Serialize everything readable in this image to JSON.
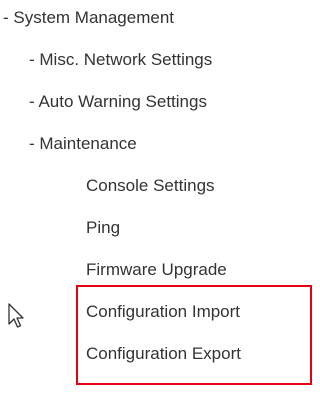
{
  "menu": {
    "system_management": "- System Management",
    "misc_network_settings": "- Misc. Network Settings",
    "auto_warning_settings": "- Auto Warning Settings",
    "maintenance": "- Maintenance",
    "console_settings": "Console Settings",
    "ping": "Ping",
    "firmware_upgrade": "Firmware Upgrade",
    "configuration_import": "Configuration Import",
    "configuration_export": "Configuration Export"
  },
  "highlight": {
    "color": "#e60012"
  },
  "cursor": {
    "icon": "arrow-pointer-icon"
  }
}
